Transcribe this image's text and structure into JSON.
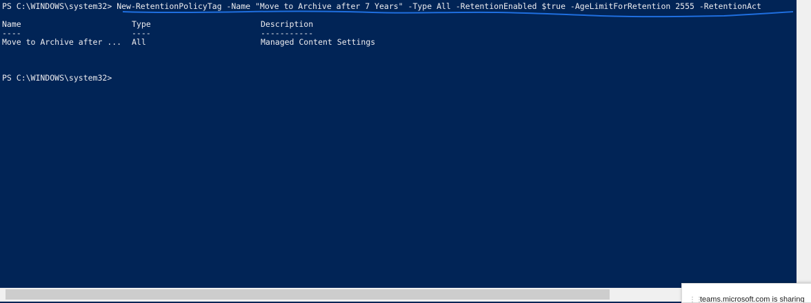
{
  "console": {
    "prompt": "PS C:\\WINDOWS\\system32>",
    "command": "New-RetentionPolicyTag -Name \"Move to Archive after 7 Years\" -Type All -RetentionEnabled $true -AgeLimitForRetention 2555 -RetentionAct",
    "columns": {
      "name_header": "Name",
      "type_header": "Type",
      "description_header": "Description",
      "name_sep": "----",
      "type_sep": "----",
      "description_sep": "-----------"
    },
    "row": {
      "name": "Move to Archive after ...",
      "type": "All",
      "description": "Managed Content Settings"
    },
    "prompt2": "PS C:\\WINDOWS\\system32>",
    "underline_color": "#1f6fe0"
  },
  "notification": {
    "text": "teams.microsoft.com is sharing"
  }
}
